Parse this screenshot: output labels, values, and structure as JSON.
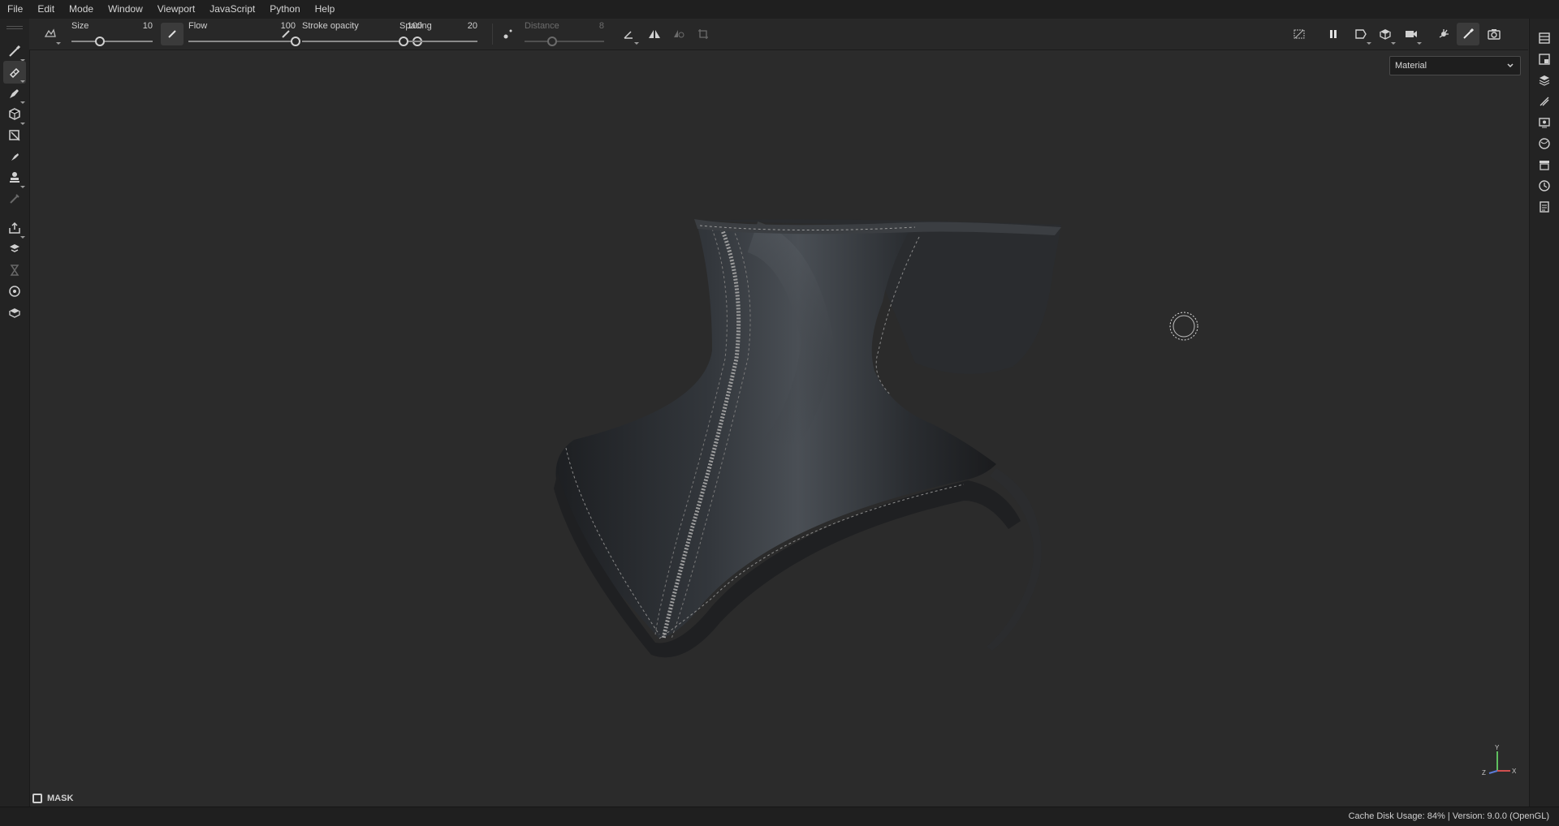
{
  "menu": [
    "File",
    "Edit",
    "Mode",
    "Window",
    "Viewport",
    "JavaScript",
    "Python",
    "Help"
  ],
  "toolbar": {
    "size": {
      "label": "Size",
      "value": "10",
      "fraction": 0.35
    },
    "flow": {
      "label": "Flow",
      "value": "100",
      "fraction": 1.0
    },
    "stroke_opacity": {
      "label": "Stroke opacity",
      "value": "100",
      "fraction": 1.0
    },
    "spacing": {
      "label": "Spacing",
      "value": "20",
      "fraction": 0.05
    },
    "distance": {
      "label": "Distance",
      "value": "8",
      "fraction": 0.35,
      "disabled": true
    }
  },
  "left_tools": [
    "paint-brush-icon",
    "eraser-icon",
    "projection-icon",
    "geometry-fill-icon",
    "smudge-icon",
    "clone-icon",
    "color-picker-icon",
    "picker-disabled-icon",
    "export-icon",
    "bake-icon",
    "iray-icon",
    "mesh-icon",
    "cube-icon"
  ],
  "right_tools": [
    "layers-panel-icon",
    "texture-set-icon",
    "layer-stack-icon",
    "properties-icon",
    "display-settings-icon",
    "shader-settings-icon",
    "assets-icon",
    "history-icon",
    "log-icon"
  ],
  "viewport": {
    "material_mode": "Material",
    "mask_label": "MASK",
    "axis": {
      "x": "X",
      "y": "Y",
      "z": "Z"
    }
  },
  "status": {
    "cache": "Cache Disk Usage:    84% | Version: 9.0.0 (OpenGL)"
  },
  "colors": {
    "accent": "#3b3b3b",
    "bg": "#2b2b2b"
  }
}
